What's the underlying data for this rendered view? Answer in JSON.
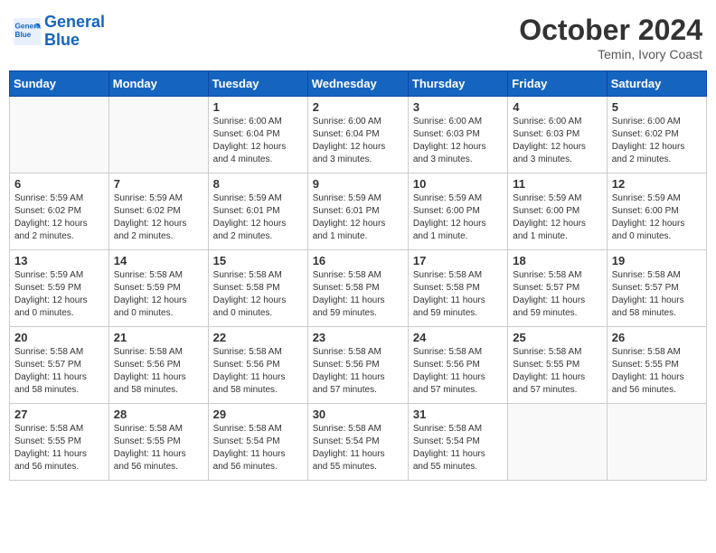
{
  "header": {
    "logo_line1": "General",
    "logo_line2": "Blue",
    "month": "October 2024",
    "location": "Temin, Ivory Coast"
  },
  "weekdays": [
    "Sunday",
    "Monday",
    "Tuesday",
    "Wednesday",
    "Thursday",
    "Friday",
    "Saturday"
  ],
  "weeks": [
    [
      {
        "day": "",
        "info": ""
      },
      {
        "day": "",
        "info": ""
      },
      {
        "day": "1",
        "info": "Sunrise: 6:00 AM\nSunset: 6:04 PM\nDaylight: 12 hours\nand 4 minutes."
      },
      {
        "day": "2",
        "info": "Sunrise: 6:00 AM\nSunset: 6:04 PM\nDaylight: 12 hours\nand 3 minutes."
      },
      {
        "day": "3",
        "info": "Sunrise: 6:00 AM\nSunset: 6:03 PM\nDaylight: 12 hours\nand 3 minutes."
      },
      {
        "day": "4",
        "info": "Sunrise: 6:00 AM\nSunset: 6:03 PM\nDaylight: 12 hours\nand 3 minutes."
      },
      {
        "day": "5",
        "info": "Sunrise: 6:00 AM\nSunset: 6:02 PM\nDaylight: 12 hours\nand 2 minutes."
      }
    ],
    [
      {
        "day": "6",
        "info": "Sunrise: 5:59 AM\nSunset: 6:02 PM\nDaylight: 12 hours\nand 2 minutes."
      },
      {
        "day": "7",
        "info": "Sunrise: 5:59 AM\nSunset: 6:02 PM\nDaylight: 12 hours\nand 2 minutes."
      },
      {
        "day": "8",
        "info": "Sunrise: 5:59 AM\nSunset: 6:01 PM\nDaylight: 12 hours\nand 2 minutes."
      },
      {
        "day": "9",
        "info": "Sunrise: 5:59 AM\nSunset: 6:01 PM\nDaylight: 12 hours\nand 1 minute."
      },
      {
        "day": "10",
        "info": "Sunrise: 5:59 AM\nSunset: 6:00 PM\nDaylight: 12 hours\nand 1 minute."
      },
      {
        "day": "11",
        "info": "Sunrise: 5:59 AM\nSunset: 6:00 PM\nDaylight: 12 hours\nand 1 minute."
      },
      {
        "day": "12",
        "info": "Sunrise: 5:59 AM\nSunset: 6:00 PM\nDaylight: 12 hours\nand 0 minutes."
      }
    ],
    [
      {
        "day": "13",
        "info": "Sunrise: 5:59 AM\nSunset: 5:59 PM\nDaylight: 12 hours\nand 0 minutes."
      },
      {
        "day": "14",
        "info": "Sunrise: 5:58 AM\nSunset: 5:59 PM\nDaylight: 12 hours\nand 0 minutes."
      },
      {
        "day": "15",
        "info": "Sunrise: 5:58 AM\nSunset: 5:58 PM\nDaylight: 12 hours\nand 0 minutes."
      },
      {
        "day": "16",
        "info": "Sunrise: 5:58 AM\nSunset: 5:58 PM\nDaylight: 11 hours\nand 59 minutes."
      },
      {
        "day": "17",
        "info": "Sunrise: 5:58 AM\nSunset: 5:58 PM\nDaylight: 11 hours\nand 59 minutes."
      },
      {
        "day": "18",
        "info": "Sunrise: 5:58 AM\nSunset: 5:57 PM\nDaylight: 11 hours\nand 59 minutes."
      },
      {
        "day": "19",
        "info": "Sunrise: 5:58 AM\nSunset: 5:57 PM\nDaylight: 11 hours\nand 58 minutes."
      }
    ],
    [
      {
        "day": "20",
        "info": "Sunrise: 5:58 AM\nSunset: 5:57 PM\nDaylight: 11 hours\nand 58 minutes."
      },
      {
        "day": "21",
        "info": "Sunrise: 5:58 AM\nSunset: 5:56 PM\nDaylight: 11 hours\nand 58 minutes."
      },
      {
        "day": "22",
        "info": "Sunrise: 5:58 AM\nSunset: 5:56 PM\nDaylight: 11 hours\nand 58 minutes."
      },
      {
        "day": "23",
        "info": "Sunrise: 5:58 AM\nSunset: 5:56 PM\nDaylight: 11 hours\nand 57 minutes."
      },
      {
        "day": "24",
        "info": "Sunrise: 5:58 AM\nSunset: 5:56 PM\nDaylight: 11 hours\nand 57 minutes."
      },
      {
        "day": "25",
        "info": "Sunrise: 5:58 AM\nSunset: 5:55 PM\nDaylight: 11 hours\nand 57 minutes."
      },
      {
        "day": "26",
        "info": "Sunrise: 5:58 AM\nSunset: 5:55 PM\nDaylight: 11 hours\nand 56 minutes."
      }
    ],
    [
      {
        "day": "27",
        "info": "Sunrise: 5:58 AM\nSunset: 5:55 PM\nDaylight: 11 hours\nand 56 minutes."
      },
      {
        "day": "28",
        "info": "Sunrise: 5:58 AM\nSunset: 5:55 PM\nDaylight: 11 hours\nand 56 minutes."
      },
      {
        "day": "29",
        "info": "Sunrise: 5:58 AM\nSunset: 5:54 PM\nDaylight: 11 hours\nand 56 minutes."
      },
      {
        "day": "30",
        "info": "Sunrise: 5:58 AM\nSunset: 5:54 PM\nDaylight: 11 hours\nand 55 minutes."
      },
      {
        "day": "31",
        "info": "Sunrise: 5:58 AM\nSunset: 5:54 PM\nDaylight: 11 hours\nand 55 minutes."
      },
      {
        "day": "",
        "info": ""
      },
      {
        "day": "",
        "info": ""
      }
    ]
  ]
}
